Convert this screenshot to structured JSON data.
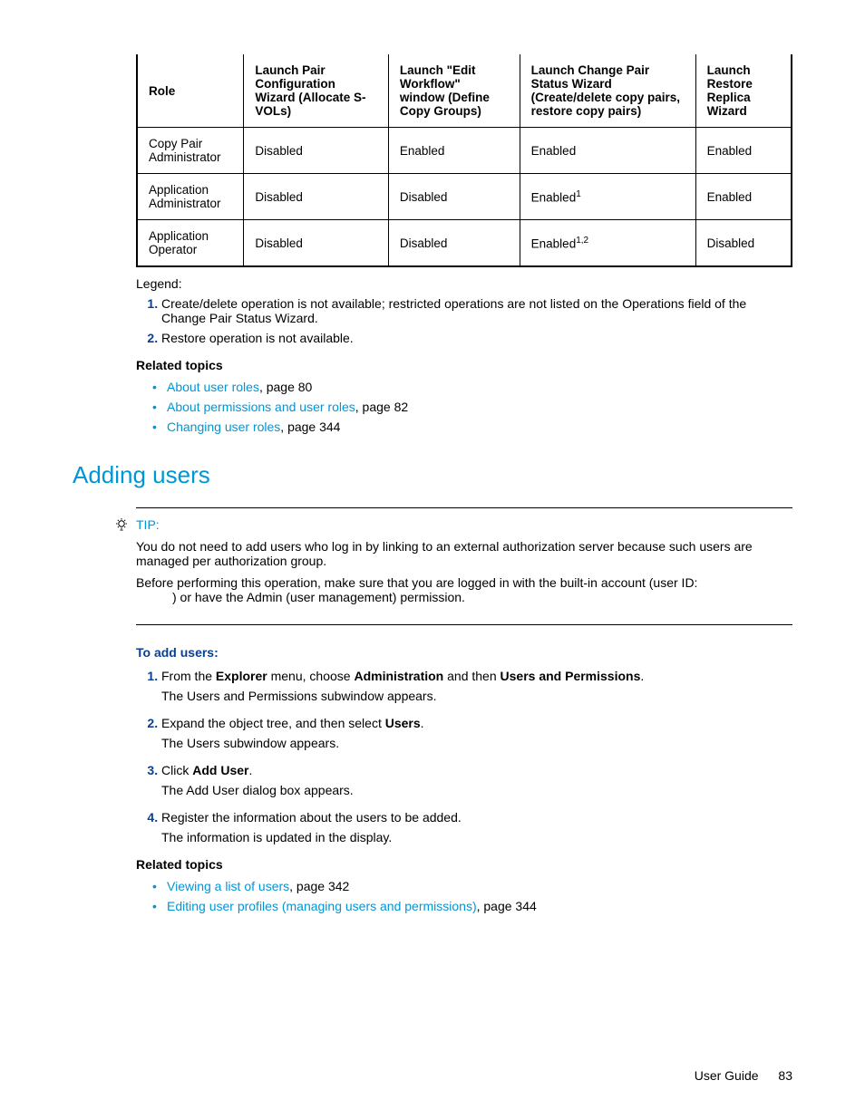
{
  "table": {
    "headers": [
      "Role",
      "Launch Pair Configuration Wizard (Allocate S-VOLs)",
      "Launch \"Edit Workflow\" window (Define Copy Groups)",
      "Launch Change Pair Status Wizard (Create/delete copy pairs, restore copy pairs)",
      "Launch Restore Replica Wizard"
    ],
    "rows": [
      {
        "role": "Copy Pair Administrator",
        "c1": "Disabled",
        "c2": "Enabled",
        "c3": "Enabled",
        "c3_sup": "",
        "c4": "Enabled"
      },
      {
        "role": "Application Administrator",
        "c1": "Disabled",
        "c2": "Disabled",
        "c3": "Enabled",
        "c3_sup": "1",
        "c4": "Enabled"
      },
      {
        "role": "Application Operator",
        "c1": "Disabled",
        "c2": "Disabled",
        "c3": "Enabled",
        "c3_sup": "1,2",
        "c4": "Disabled"
      }
    ]
  },
  "legend": {
    "label": "Legend:",
    "items": [
      "Create/delete operation is not available; restricted operations are not listed on the Operations field of the Change Pair Status Wizard.",
      "Restore operation is not available."
    ]
  },
  "related1": {
    "heading": "Related topics",
    "items": [
      {
        "link": "About user roles",
        "suffix": ", page 80"
      },
      {
        "link": "About permissions and user roles",
        "suffix": ", page 82"
      },
      {
        "link": "Changing user roles",
        "suffix": ", page 344"
      }
    ]
  },
  "section_heading": "Adding users",
  "tip": {
    "label": "TIP:",
    "p1": "You do not need to add users who log in by linking to an external authorization server because such users are managed per authorization group.",
    "p2a": "Before performing this operation, make sure that you are logged in with the built-in account (user ID:",
    "p2b": ") or have the Admin (user management) permission."
  },
  "procedure": {
    "heading": "To add users:",
    "steps": [
      {
        "parts": [
          {
            "t": "From the "
          },
          {
            "t": "Explorer",
            "b": true
          },
          {
            "t": " menu, choose "
          },
          {
            "t": "Administration",
            "b": true
          },
          {
            "t": " and then "
          },
          {
            "t": "Users and Permissions",
            "b": true
          },
          {
            "t": "."
          }
        ],
        "after": "The Users and Permissions subwindow appears."
      },
      {
        "parts": [
          {
            "t": "Expand the object tree, and then select "
          },
          {
            "t": "Users",
            "b": true
          },
          {
            "t": "."
          }
        ],
        "after": "The Users subwindow appears."
      },
      {
        "parts": [
          {
            "t": "Click "
          },
          {
            "t": "Add User",
            "b": true
          },
          {
            "t": "."
          }
        ],
        "after": "The Add User dialog box appears."
      },
      {
        "parts": [
          {
            "t": "Register the information about the users to be added."
          }
        ],
        "after": "The information is updated in the display."
      }
    ]
  },
  "related2": {
    "heading": "Related topics",
    "items": [
      {
        "link": "Viewing a list of users",
        "suffix": ", page 342"
      },
      {
        "link": "Editing user profiles (managing users and permissions)",
        "suffix": ", page 344"
      }
    ]
  },
  "footer": {
    "label": "User Guide",
    "page": "83"
  }
}
